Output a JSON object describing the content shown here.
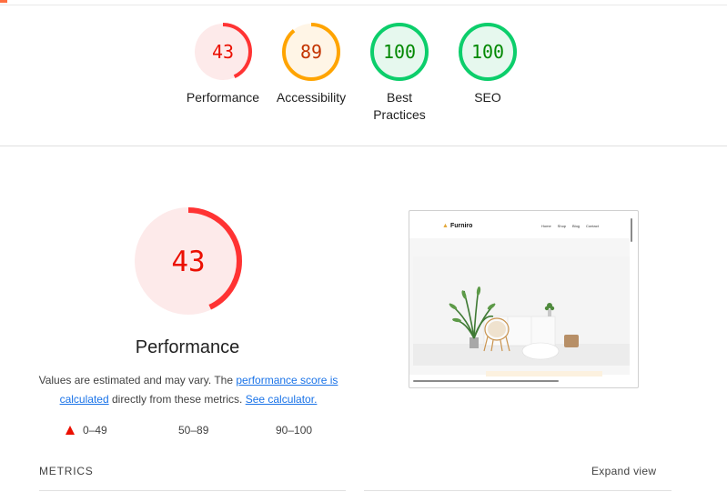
{
  "scores": [
    {
      "value": "43",
      "label": "Performance",
      "fraction": 0.43,
      "status": "fail"
    },
    {
      "value": "89",
      "label": "Accessibility",
      "fraction": 0.89,
      "status": "average"
    },
    {
      "value": "100",
      "label": "Best Practices",
      "fraction": 1.0,
      "status": "pass"
    },
    {
      "value": "100",
      "label": "SEO",
      "fraction": 1.0,
      "status": "pass"
    }
  ],
  "colors": {
    "fail_fg": "#eb0f00",
    "fail_bg": "#fdeaea",
    "average_fg": "#c33300",
    "average_ring": "#ffa400",
    "average_bg": "#fff5e6",
    "pass_fg": "#008800",
    "pass_ring": "#0cce6b",
    "pass_bg": "#e6f8ee",
    "ring_fail": "#ff3333"
  },
  "performance": {
    "score": "43",
    "fraction": 0.43,
    "title": "Performance",
    "desc_prefix": "Values are estimated and may vary. The ",
    "link_score": "performance score is calculated",
    "desc_middle": " directly from these metrics. ",
    "link_calc": "See calculator."
  },
  "legend": {
    "fail": "0–49",
    "average": "50–89",
    "pass": "90–100"
  },
  "screenshot": {
    "brand": "Furniro",
    "nav_links": [
      "Home",
      "Shop",
      "Blog",
      "Contact"
    ]
  },
  "metrics": {
    "label": "METRICS",
    "expand": "Expand view"
  }
}
